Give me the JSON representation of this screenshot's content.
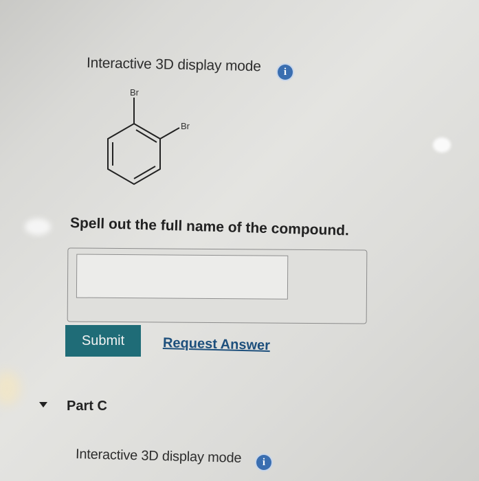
{
  "partB": {
    "display_mode_label": "Interactive 3D display mode",
    "info_icon_glyph": "i",
    "molecule": {
      "substituent_top": "Br",
      "substituent_side": "Br"
    },
    "question": "Spell out the full name of the compound.",
    "answer": {
      "value": "",
      "placeholder": ""
    },
    "submit_label": "Submit",
    "request_answer_label": "Request Answer"
  },
  "partC": {
    "title": "Part C",
    "display_mode_label": "Interactive 3D display mode",
    "info_icon_glyph": "i"
  },
  "colors": {
    "submit_bg": "#1f6c77",
    "link": "#1d4f7c",
    "info_icon": "#3a6eb0"
  },
  "icons": [
    "info-icon",
    "caret-down-icon"
  ]
}
